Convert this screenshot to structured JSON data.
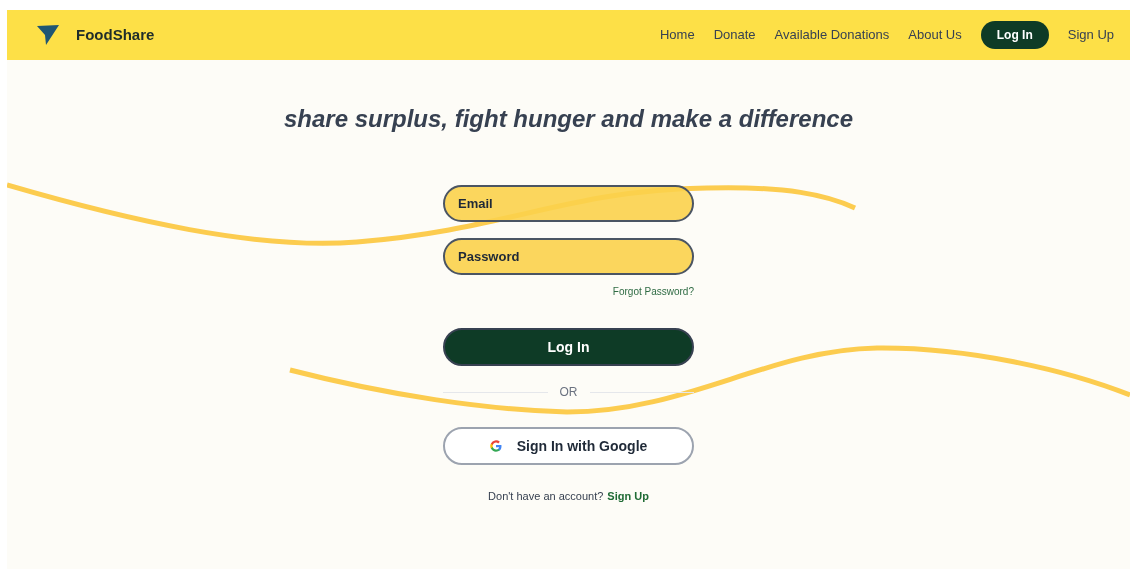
{
  "brand": {
    "name": "FoodShare"
  },
  "nav": [
    {
      "label": "Home",
      "selected": false
    },
    {
      "label": "Donate",
      "selected": false
    },
    {
      "label": "Available Donations",
      "selected": false
    },
    {
      "label": "About Us",
      "selected": false
    },
    {
      "label": "Log In",
      "selected": true
    },
    {
      "label": "Sign Up",
      "selected": false
    }
  ],
  "tagline": "share surplus, fight hunger and make a difference",
  "form": {
    "email": {
      "placeholder": "Email"
    },
    "password": {
      "placeholder": "Password"
    },
    "forgot_link": "Forgot Password?",
    "submit": "Log In",
    "divider": "OR",
    "google_button": "Sign In with Google",
    "signup_prompt": "Don't have an account?",
    "signup_link": "Sign Up"
  }
}
